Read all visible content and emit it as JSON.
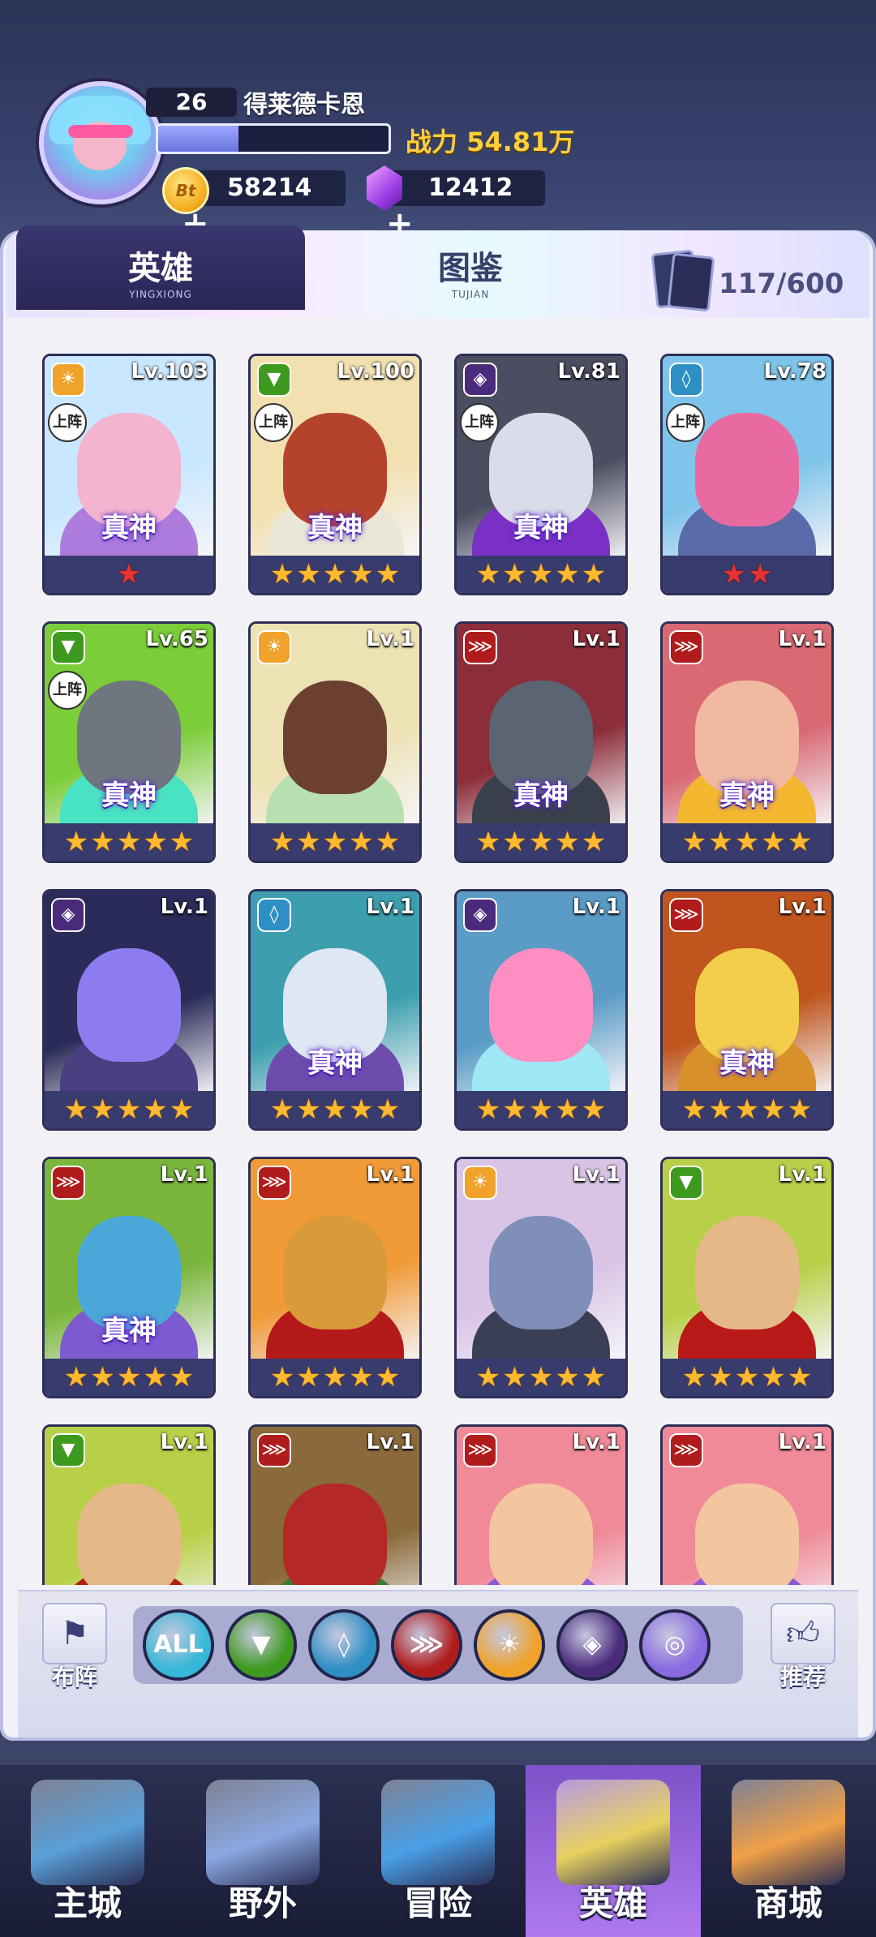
{
  "player": {
    "level": "26",
    "name": "得莱德卡恩",
    "xp_fraction": 0.35,
    "power": "战力 54.81万"
  },
  "resources": {
    "coin_icon_text": "Bt",
    "coins": "58214",
    "gems": "12412",
    "plus": "+"
  },
  "tabs": [
    {
      "label": "英雄",
      "sub": "YINGXIONG",
      "active": true
    },
    {
      "label": "图鉴",
      "sub": "TUJIAN",
      "active": false
    }
  ],
  "collection_count": "117/600",
  "tags": {
    "on_team": "上阵",
    "true_god": "真神"
  },
  "star_glyph": "★",
  "elements": {
    "light": {
      "color": "#f0a22a",
      "glyph": "☀"
    },
    "nature": {
      "color": "#3e9a1e",
      "glyph": "▼"
    },
    "void": {
      "color": "#4a2a7a",
      "glyph": "◈"
    },
    "water": {
      "color": "#2d8fc4",
      "glyph": "◊"
    },
    "fire": {
      "color": "#b01c1c",
      "glyph": "⋙"
    }
  },
  "heroes": [
    {
      "level": "Lv.103",
      "element": "light",
      "on_team": true,
      "true_god": true,
      "stars": 1,
      "star_color": "red",
      "bg": "#c9e7ff",
      "head": "#f3b4d0",
      "body": "#ad7cdc"
    },
    {
      "level": "Lv.100",
      "element": "nature",
      "on_team": true,
      "true_god": true,
      "stars": 5,
      "star_color": "gold",
      "bg": "#f3e0b0",
      "head": "#b5432c",
      "body": "#eae7d6"
    },
    {
      "level": "Lv.81",
      "element": "void",
      "on_team": true,
      "true_god": true,
      "stars": 5,
      "star_color": "gold",
      "bg": "#4b4d60",
      "head": "#d9dde9",
      "body": "#7c2fc4"
    },
    {
      "level": "Lv.78",
      "element": "water",
      "on_team": true,
      "true_god": false,
      "stars": 2,
      "star_color": "red",
      "bg": "#7fc4ea",
      "head": "#e86aa0",
      "body": "#5b6aa8"
    },
    {
      "level": "Lv.65",
      "element": "nature",
      "on_team": true,
      "true_god": true,
      "stars": 5,
      "star_color": "gold",
      "bg": "#7ccd3a",
      "head": "#6f767e",
      "body": "#48e3c2"
    },
    {
      "level": "Lv.1",
      "element": "light",
      "on_team": false,
      "true_god": false,
      "stars": 5,
      "star_color": "gold",
      "bg": "#ede2b4",
      "head": "#6b4030",
      "body": "#b8e0b0"
    },
    {
      "level": "Lv.1",
      "element": "fire",
      "on_team": false,
      "true_god": true,
      "stars": 5,
      "star_color": "gold",
      "bg": "#8b2e3a",
      "head": "#5b6572",
      "body": "#3a3f4c"
    },
    {
      "level": "Lv.1",
      "element": "fire",
      "on_team": false,
      "true_god": true,
      "stars": 5,
      "star_color": "gold",
      "bg": "#d96a74",
      "head": "#f0b9a0",
      "body": "#f4b830"
    },
    {
      "level": "Lv.1",
      "element": "void",
      "on_team": false,
      "true_god": false,
      "stars": 5,
      "star_color": "gold",
      "bg": "#2a2b58",
      "head": "#8c7cf0",
      "body": "#4a3f80"
    },
    {
      "level": "Lv.1",
      "element": "water",
      "on_team": false,
      "true_god": true,
      "stars": 5,
      "star_color": "gold",
      "bg": "#3d9fae",
      "head": "#dfe6f4",
      "body": "#6d4cae"
    },
    {
      "level": "Lv.1",
      "element": "void",
      "on_team": false,
      "true_god": false,
      "stars": 5,
      "star_color": "gold",
      "bg": "#5a9cc6",
      "head": "#ff8fc2",
      "body": "#9fe7f5"
    },
    {
      "level": "Lv.1",
      "element": "fire",
      "on_team": false,
      "true_god": true,
      "stars": 5,
      "star_color": "gold",
      "bg": "#c0561e",
      "head": "#f2ce4a",
      "body": "#d8902a"
    },
    {
      "level": "Lv.1",
      "element": "fire",
      "on_team": false,
      "true_god": true,
      "stars": 5,
      "star_color": "gold",
      "bg": "#7ab63c",
      "head": "#4aa8d8",
      "body": "#7e5ad0"
    },
    {
      "level": "Lv.1",
      "element": "fire",
      "on_team": false,
      "true_god": false,
      "stars": 5,
      "star_color": "gold",
      "bg": "#f09a38",
      "head": "#d89a3a",
      "body": "#b51a1a"
    },
    {
      "level": "Lv.1",
      "element": "light",
      "on_team": false,
      "true_god": false,
      "stars": 5,
      "star_color": "gold",
      "bg": "#d9c4e6",
      "head": "#7f8fb8",
      "body": "#3a3f55"
    },
    {
      "level": "Lv.1",
      "element": "nature",
      "on_team": false,
      "true_god": false,
      "stars": 5,
      "star_color": "gold",
      "bg": "#b8d048",
      "head": "#e5b888",
      "body": "#b81a1a"
    },
    {
      "level": "Lv.1",
      "element": "nature",
      "on_team": false,
      "true_god": false,
      "stars": 0,
      "star_color": "gold",
      "bg": "#b8d048",
      "head": "#e5b888",
      "body": "#b81a1a"
    },
    {
      "level": "Lv.1",
      "element": "fire",
      "on_team": false,
      "true_god": false,
      "stars": 0,
      "star_color": "gold",
      "bg": "#8a6a3a",
      "head": "#b52828",
      "body": "#3e7a32"
    },
    {
      "level": "Lv.1",
      "element": "fire",
      "on_team": false,
      "true_god": false,
      "stars": 0,
      "star_color": "gold",
      "bg": "#f08a98",
      "head": "#f4c6a0",
      "body": "#8a5ad8"
    },
    {
      "level": "Lv.1",
      "element": "fire",
      "on_team": false,
      "true_god": false,
      "stars": 0,
      "star_color": "gold",
      "bg": "#f08a98",
      "head": "#f4c6a0",
      "body": "#8a5ad8"
    }
  ],
  "bottom_tools": {
    "formation": "布阵",
    "recommend": "推荐"
  },
  "filters": [
    {
      "label": "ALL",
      "key": "all",
      "color": "#36b8d8"
    },
    {
      "label": "",
      "key": "nature",
      "color": "#3e9a1e"
    },
    {
      "label": "",
      "key": "water",
      "color": "#2d8fc4"
    },
    {
      "label": "",
      "key": "fire",
      "color": "#b01c1c"
    },
    {
      "label": "",
      "key": "light",
      "color": "#f0a22a"
    },
    {
      "label": "",
      "key": "void",
      "color": "#4a2a7a"
    },
    {
      "label": "",
      "key": "mystic",
      "color": "#8a6ae0"
    }
  ],
  "nav": [
    {
      "label": "主城",
      "color": "#5aa0d8",
      "active": false
    },
    {
      "label": "野外",
      "color": "#8aa8e0",
      "active": false
    },
    {
      "label": "冒险",
      "color": "#4aa0e8",
      "active": false
    },
    {
      "label": "英雄",
      "color": "#e8d060",
      "active": true
    },
    {
      "label": "商城",
      "color": "#f0a048",
      "active": false
    }
  ]
}
